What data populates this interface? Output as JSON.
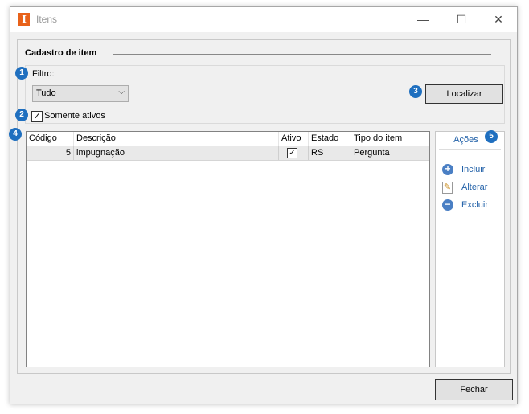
{
  "window": {
    "title": "Itens",
    "app_icon_glyph": "I",
    "accent": "#e8621a"
  },
  "controls": {
    "minimize": "—",
    "maximize": "☐",
    "close": "✕"
  },
  "group": {
    "title": "Cadastro de item"
  },
  "filter": {
    "label": "Filtro:",
    "selected": "Tudo",
    "search_button": "Localizar",
    "only_active_label": "Somente ativos",
    "only_active_checked": true
  },
  "grid": {
    "columns": [
      "Código",
      "Descrição",
      "Ativo",
      "Estado",
      "Tipo do item"
    ],
    "rows": [
      {
        "codigo": "5",
        "descricao": "impugnação",
        "ativo": true,
        "estado": "RS",
        "tipo": "Pergunta"
      }
    ]
  },
  "actions": {
    "title": "Ações",
    "items": [
      {
        "label": "Incluir",
        "icon": "plus-circle-icon"
      },
      {
        "label": "Alterar",
        "icon": "edit-pencil-icon"
      },
      {
        "label": "Excluir",
        "icon": "minus-circle-icon"
      }
    ]
  },
  "footer": {
    "close_button": "Fechar"
  },
  "markers": [
    "1",
    "2",
    "3",
    "4",
    "5"
  ],
  "colors": {
    "marker": "#1f6fbf",
    "link": "#1f5fa7"
  }
}
